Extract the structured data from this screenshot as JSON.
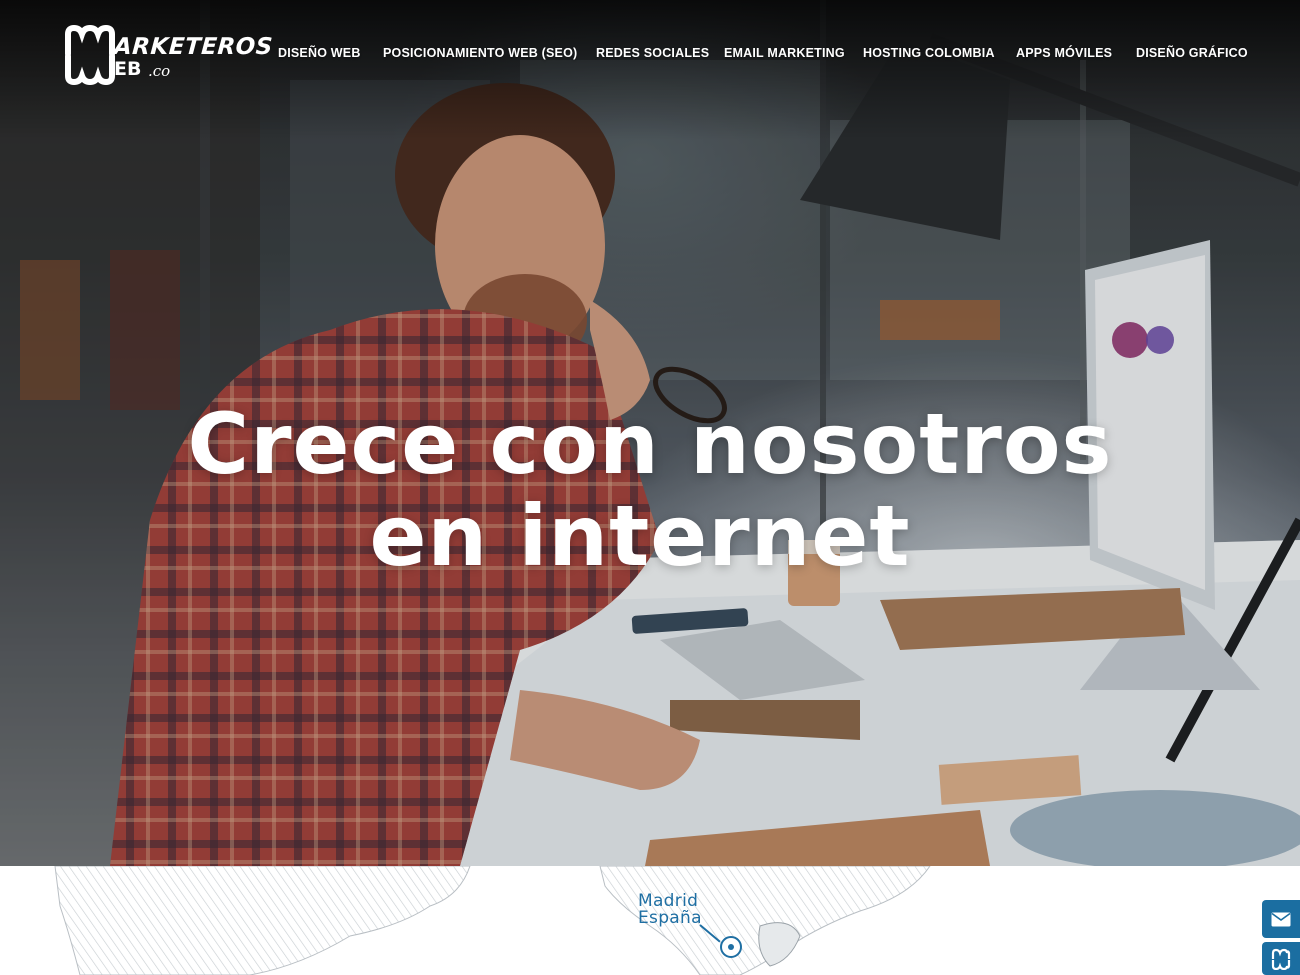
{
  "brand": {
    "logo_word1": "ARKETEROS",
    "logo_word2": "EB",
    "logo_suffix": ".co",
    "logo_icon": "mw-monogram-icon"
  },
  "nav": {
    "items": [
      {
        "label": "DISEÑO WEB"
      },
      {
        "label": "POSICIONAMIENTO WEB (SEO)"
      },
      {
        "label": "REDES SOCIALES"
      },
      {
        "label": "EMAIL MARKETING"
      },
      {
        "label": "HOSTING COLOMBIA"
      },
      {
        "label": "APPS MÓVILES"
      },
      {
        "label": "DISEÑO GRÁFICO"
      }
    ]
  },
  "hero": {
    "headline_line1": "Crece con nosotros",
    "headline_line2": "en internet"
  },
  "map": {
    "city": "Madrid",
    "country": "España"
  },
  "side_buttons": {
    "mail_icon": "envelope-icon",
    "brand_icon": "mw-monogram-icon"
  },
  "colors": {
    "accent": "#1b6ea1",
    "map_text": "#1f6fa3",
    "nav_text": "#ffffff"
  }
}
